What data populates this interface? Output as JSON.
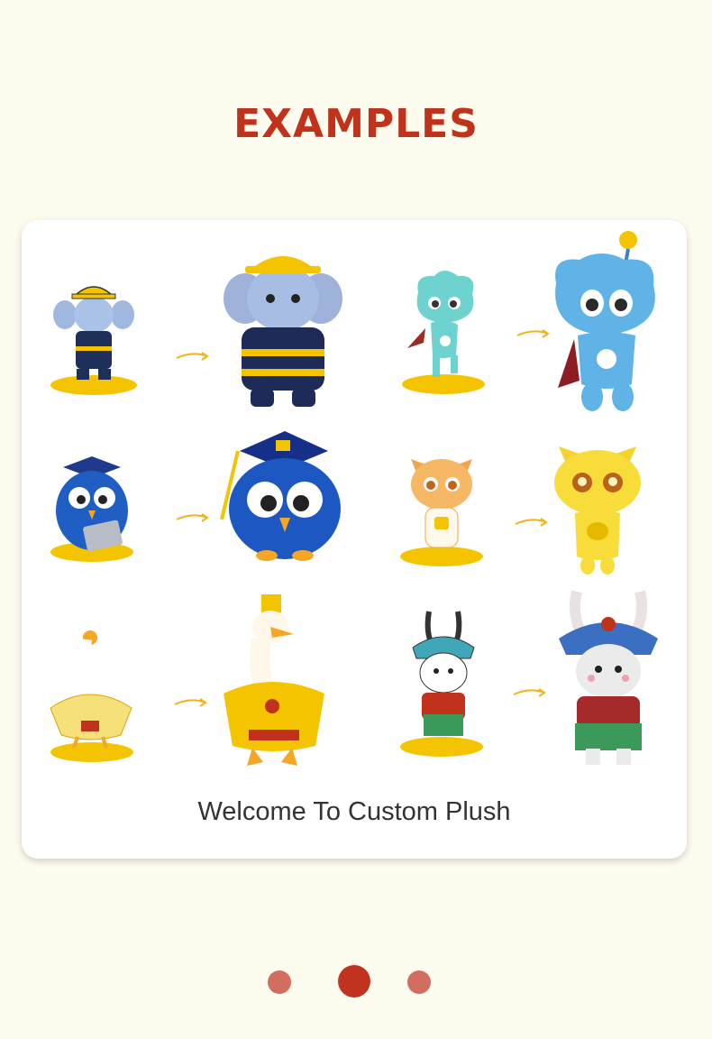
{
  "heading": "EXAMPLES",
  "caption": "Welcome To Custom Plush",
  "colors": {
    "accent": "#c0321b",
    "pad": "#f5c400",
    "dot": "#d26e5f",
    "dot_active": "#c1331f"
  },
  "examples": [
    {
      "name": "firefighter-elephant"
    },
    {
      "name": "alien-mascot"
    },
    {
      "name": "graduate-owl"
    },
    {
      "name": "orange-cat"
    },
    {
      "name": "chinese-goose"
    },
    {
      "name": "opera-rabbit"
    }
  ],
  "carousel": {
    "count": 3,
    "active_index": 1
  }
}
